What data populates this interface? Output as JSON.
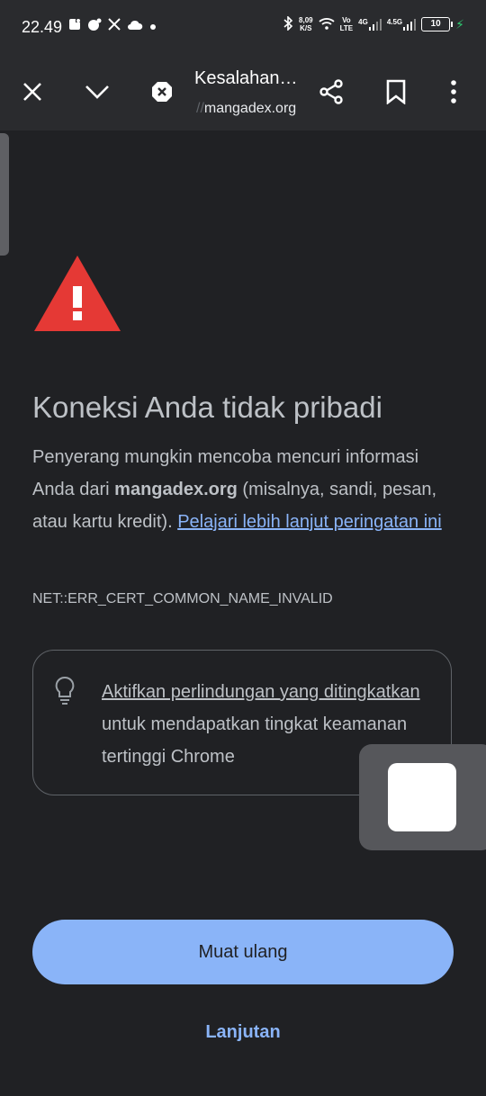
{
  "status_bar": {
    "time": "22.49",
    "network_speed": "8,09",
    "network_speed_unit": "K/S",
    "volte_label_top": "Vo",
    "volte_label_bottom": "LTE",
    "signal1_label": "4G",
    "signal2_label": "4.5G",
    "battery": "10"
  },
  "toolbar": {
    "title": "Kesalahan…",
    "url_prefix": "//",
    "url": "mangadex.org"
  },
  "page": {
    "heading": "Koneksi Anda tidak pribadi",
    "desc_part1": "Penyerang mungkin mencoba mencuri informasi Anda dari ",
    "desc_site": "mangadex.org",
    "desc_part2": " (misalnya, sandi, pesan, atau kartu kredit). ",
    "desc_link": "Pelajari lebih lanjut peringatan ini",
    "error_code": "NET::ERR_CERT_COMMON_NAME_INVALID",
    "protection_link": "Aktifkan perlindungan yang ditingkatkan",
    "protection_text": " untuk mendapatkan tingkat keamanan tertinggi Chrome",
    "reload_label": "Muat ulang",
    "advanced_label": "Lanjutan"
  },
  "colors": {
    "background": "#202124",
    "accent_blue": "#8ab4f8",
    "warning_red": "#e53935"
  }
}
